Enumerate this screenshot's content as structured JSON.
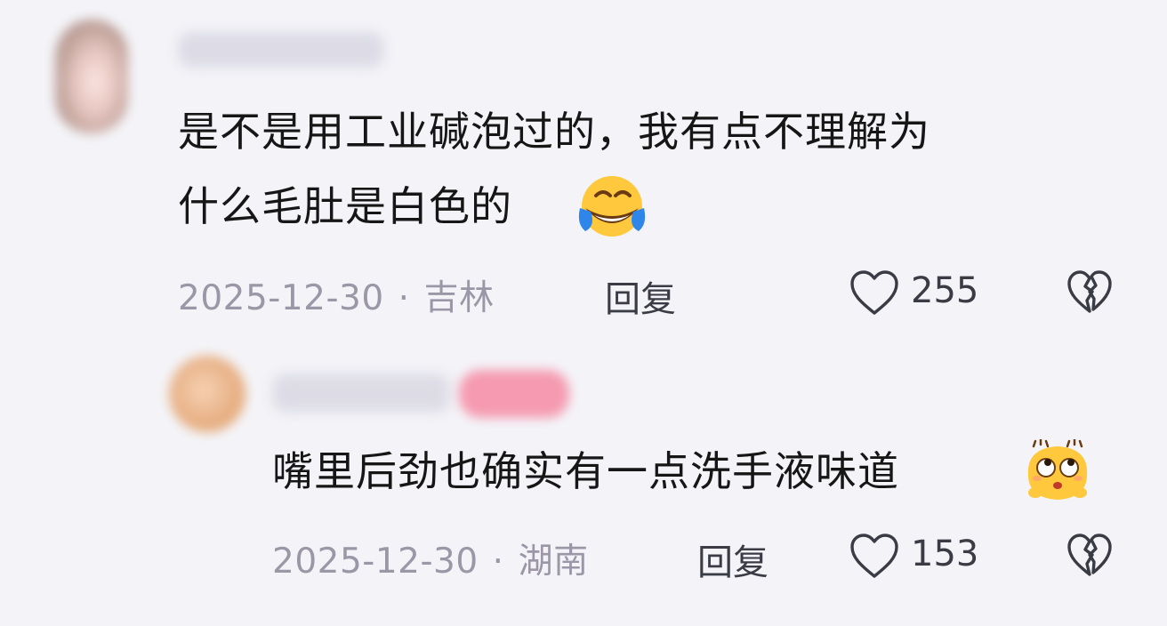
{
  "comments": [
    {
      "text_line1": "是不是用工业碱泡过的，我有点不理解为",
      "text_line2": "什么毛肚是白色的",
      "emoji": "laughing-crying-emoji",
      "date": "2025-12-30",
      "separator": "·",
      "location": "吉林",
      "reply_label": "回复",
      "like_count": "255",
      "like_icon": "heart-outline-icon",
      "dislike_icon": "broken-heart-icon"
    },
    {
      "text_line1": "嘴里后劲也确实有一点洗手液味道",
      "emoji": "sweating-eye-roll-emoji",
      "date": "2025-12-30",
      "separator": "·",
      "location": "湖南",
      "reply_label": "回复",
      "like_count": "153",
      "like_icon": "heart-outline-icon",
      "dislike_icon": "broken-heart-icon"
    }
  ],
  "colors": {
    "background": "#f4f4f8",
    "text": "#161616",
    "meta": "#9b97a7",
    "action": "#3b3b45",
    "emoji_yellow": "#ffc83d",
    "emoji_blue": "#2f86ea"
  }
}
